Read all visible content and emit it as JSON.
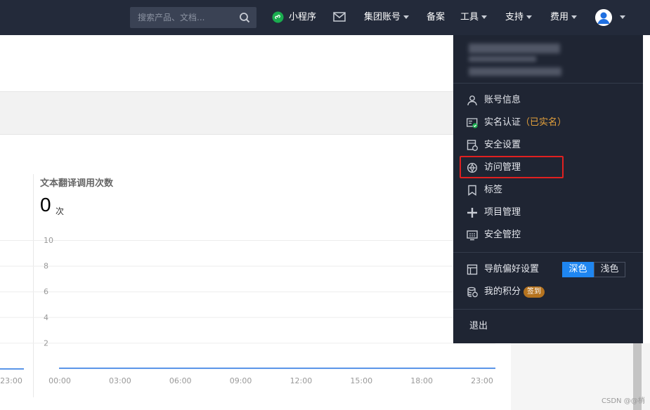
{
  "topbar": {
    "search_placeholder": "搜索产品、文档...",
    "mini_program": "小程序",
    "group_account": "集团账号",
    "filing": "备案",
    "tools": "工具",
    "support": "支持",
    "billing": "费用"
  },
  "user_menu": {
    "items": [
      {
        "label": "账号信息",
        "icon": "user-icon"
      },
      {
        "label": "实名认证",
        "tag": "（已实名）",
        "icon": "id-card-verified-icon"
      },
      {
        "label": "安全设置",
        "icon": "shield-settings-icon"
      },
      {
        "label": "访问管理",
        "icon": "access-management-icon"
      },
      {
        "label": "标签",
        "icon": "bookmark-icon"
      },
      {
        "label": "项目管理",
        "icon": "project-icon"
      },
      {
        "label": "安全管控",
        "icon": "security-control-icon"
      }
    ],
    "nav_pref": {
      "label": "导航偏好设置",
      "dark": "深色",
      "light": "浅色",
      "selected": "深色"
    },
    "points": {
      "label": "我的积分",
      "badge": "签到"
    },
    "logout": "退出"
  },
  "chart_data": {
    "type": "line",
    "title": "文本翻译调用次数",
    "total": "0",
    "unit": "次",
    "x": [
      "00:00",
      "03:00",
      "06:00",
      "09:00",
      "12:00",
      "15:00",
      "18:00",
      "23:00"
    ],
    "yticks": [
      "10",
      "8",
      "6",
      "4",
      "2"
    ],
    "ylim": [
      0,
      10
    ],
    "series": [
      {
        "values": [
          0,
          0,
          0,
          0,
          0,
          0,
          0,
          0
        ]
      }
    ],
    "left_chart_last_xtick": "23:00",
    "grid": true,
    "color": "#1f6fe0"
  },
  "watermark": "CSDN @@梢"
}
